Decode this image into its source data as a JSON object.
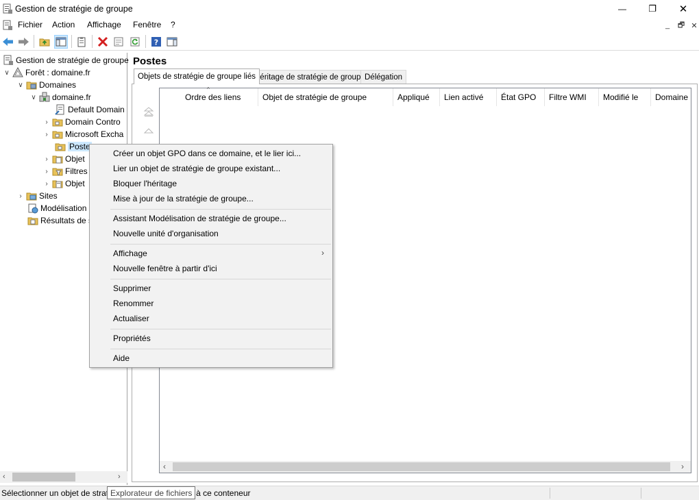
{
  "window": {
    "title": "Gestion de stratégie de groupe",
    "minimize": "—",
    "maximize": "❐",
    "close": "✕"
  },
  "menubar": {
    "items": [
      "Fichier",
      "Action",
      "Affichage",
      "Fenêtre",
      "?"
    ],
    "mdi_minimize": "_",
    "mdi_restore": "🗗",
    "mdi_close": "✕"
  },
  "tree": {
    "root": "Gestion de stratégie de groupe",
    "forest": "Forêt : domaine.fr",
    "domains": "Domaines",
    "domain": "domaine.fr",
    "default_domain": "Default Domain",
    "domain_controllers": "Domain Contro",
    "microsoft_exchange": "Microsoft Excha",
    "postes": "Poste",
    "objets1": "Objet",
    "filtres": "Filtres",
    "objets2": "Objet",
    "sites": "Sites",
    "modelisation": "Modélisation",
    "resultats": "Résultats de s"
  },
  "right": {
    "title": "Postes",
    "tabs": [
      "Objets de stratégie de groupe liés",
      "Héritage de stratégie de groupe",
      "Délégation"
    ],
    "columns": [
      "Ordre des liens",
      "Objet de stratégie de groupe",
      "Appliqué",
      "Lien activé",
      "État GPO",
      "Filtre WMI",
      "Modifié le",
      "Domaine"
    ]
  },
  "context_menu": {
    "items": [
      "Créer un objet GPO dans ce domaine, et le lier ici...",
      "Lier un objet de stratégie de groupe existant...",
      "Bloquer l'héritage",
      "Mise à jour de la stratégie de groupe...",
      "Assistant Modélisation de stratégie de groupe...",
      "Nouvelle unité d'organisation",
      "Affichage",
      "Nouvelle fenêtre à partir d'ici",
      "Supprimer",
      "Renommer",
      "Actualiser",
      "Propriétés",
      "Aide"
    ]
  },
  "status": {
    "text": "Sélectionner un objet de strat",
    "text_tail": "à ce conteneur",
    "tooltip": "Explorateur de fichiers"
  },
  "colors": {
    "selection": "#cce8ff",
    "menu_bg": "#f2f2f2",
    "folder": "#e8c25a"
  }
}
